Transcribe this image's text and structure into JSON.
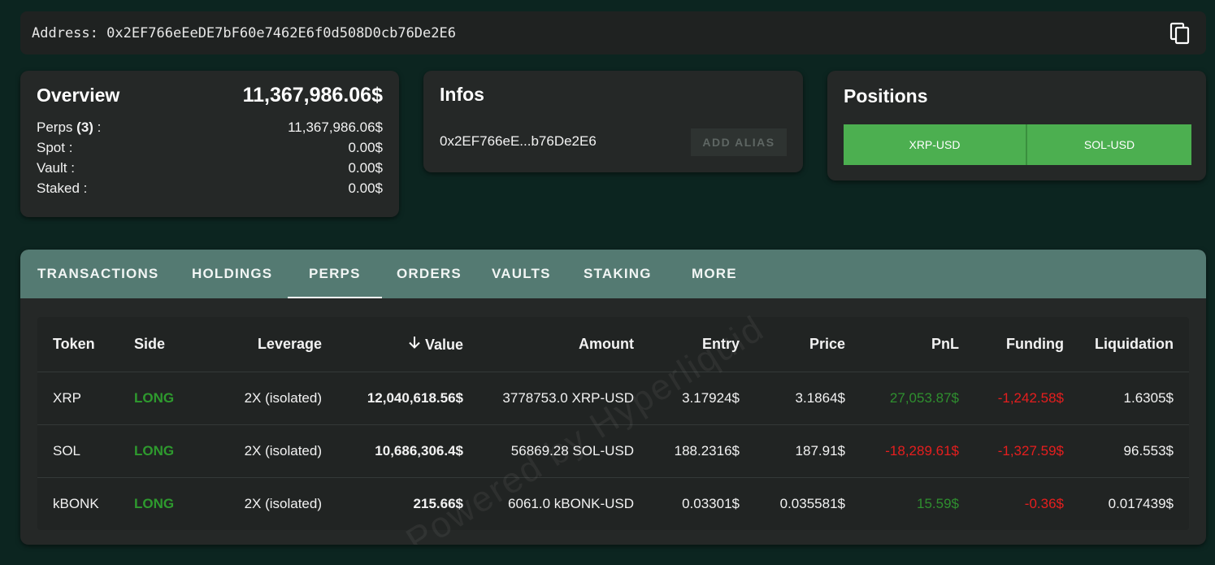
{
  "address_bar": {
    "label": "Address: 0x2EF766eEeDE7bF60e7462E6f0d508D0cb76De2E6",
    "copy_icon": "copy-icon"
  },
  "overview": {
    "title": "Overview",
    "total": "11,367,986.06$",
    "perps_label": "Perps",
    "perps_count": "(3)",
    "perps_colon": " :",
    "perps_value": "11,367,986.06$",
    "spot_label": "Spot :",
    "spot_value": "0.00$",
    "vault_label": "Vault :",
    "vault_value": "0.00$",
    "staked_label": "Staked :",
    "staked_value": "0.00$"
  },
  "infos": {
    "title": "Infos",
    "short_address": "0x2EF766eE...b76De2E6",
    "alias_button": "ADD ALIAS"
  },
  "positions": {
    "title": "Positions",
    "buttons": [
      "XRP-USD",
      "SOL-USD"
    ]
  },
  "tabs": [
    "TRANSACTIONS",
    "HOLDINGS",
    "PERPS",
    "ORDERS",
    "VAULTS",
    "STAKING",
    "MORE"
  ],
  "active_tab": "PERPS",
  "table": {
    "headers": [
      "Token",
      "Side",
      "Leverage",
      "Value",
      "Amount",
      "Entry",
      "Price",
      "PnL",
      "Funding",
      "Liquidation"
    ],
    "sort_icon": "arrow-down-icon",
    "rows": [
      [
        "XRP",
        "LONG",
        "2X (isolated)",
        "12,040,618.56$",
        "3778753.0 XRP-USD",
        "3.17924$",
        "3.1864$",
        "27,053.87$",
        "-1,242.58$",
        "1.6305$"
      ],
      [
        "SOL",
        "LONG",
        "2X (isolated)",
        "10,686,306.4$",
        "56869.28 SOL-USD",
        "188.2316$",
        "187.91$",
        "-18,289.61$",
        "-1,327.59$",
        "96.553$"
      ],
      [
        "kBONK",
        "LONG",
        "2X (isolated)",
        "215.66$",
        "6061.0 kBONK-USD",
        "0.03301$",
        "0.035581$",
        "15.59$",
        "-0.36$",
        "0.017439$"
      ]
    ]
  },
  "watermark": "Powered by Hyperliquid",
  "colors": {
    "background": "#0c2520",
    "card": "#252827",
    "tab_bar": "#547a72",
    "position_button": "#4caf50",
    "long": "#2e9a2e",
    "positive": "#2f8f2f",
    "negative": "#e61e1e"
  }
}
